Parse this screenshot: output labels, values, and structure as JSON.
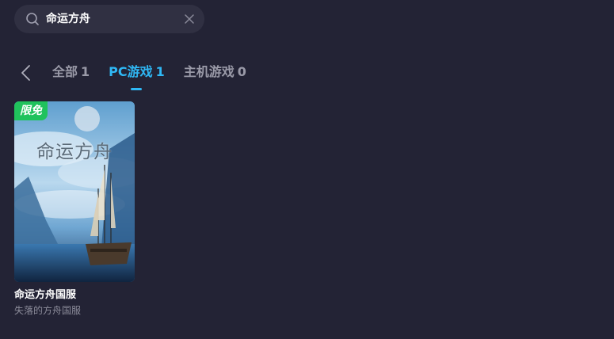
{
  "search": {
    "value": "命运方舟"
  },
  "tabs": [
    {
      "label": "全部",
      "count": "1",
      "active": false
    },
    {
      "label": "PC游戏",
      "count": "1",
      "active": true
    },
    {
      "label": "主机游戏",
      "count": "0",
      "active": false
    }
  ],
  "results": [
    {
      "badge": "限免",
      "cover_text": "命运方舟",
      "title": "命运方舟国服",
      "subtitle": "失落的方舟国服"
    }
  ],
  "colors": {
    "background": "#232335",
    "search_bg": "#303042",
    "accent": "#2fb8f5",
    "badge": "#20c25c",
    "inactive_tab": "#9a9aa8"
  },
  "icons": {
    "search": "search-icon",
    "clear": "close-icon",
    "back": "chevron-left-icon"
  }
}
